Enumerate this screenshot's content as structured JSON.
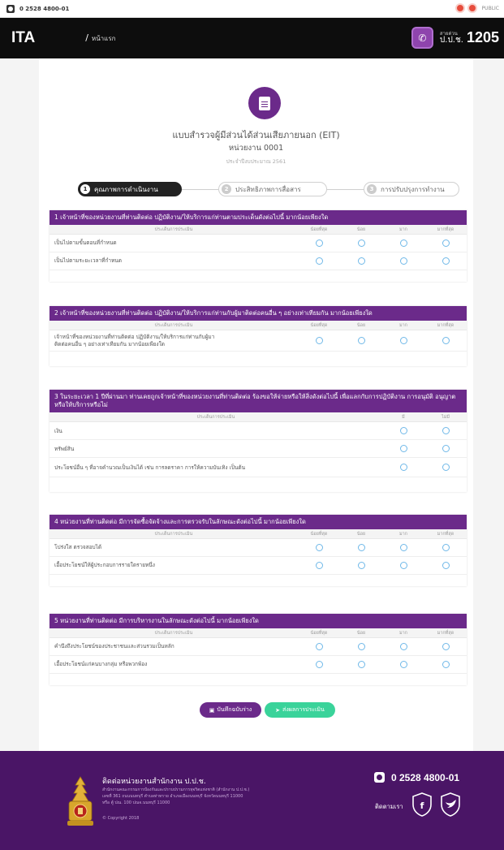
{
  "topbar": {
    "phone": "0 2528 4800-01",
    "public_label": "PUBLIC"
  },
  "header": {
    "logo": "ITA",
    "breadcrumb": "หน้าแรก",
    "hotline_label": "สายด่วน",
    "hotline_org": "ป.ป.ช.",
    "hotline_number": "1205"
  },
  "form": {
    "title": "แบบสำรวจผู้มีส่วนได้ส่วนเสียภายนอก (EIT)",
    "agency": "หน่วยงาน 0001",
    "year": "ประจำปีงบประมาณ 2561"
  },
  "steps": [
    {
      "num": "1",
      "label": "คุณภาพการดำเนินงาน"
    },
    {
      "num": "2",
      "label": "ประสิทธิภาพการสื่อสาร"
    },
    {
      "num": "3",
      "label": "การปรับปรุงการทำงาน"
    }
  ],
  "scale4": [
    "น้อยที่สุด",
    "น้อย",
    "มาก",
    "มากที่สุด"
  ],
  "scale2": [
    "มี",
    "ไม่มี"
  ],
  "sections": [
    {
      "title": "1 เจ้าหน้าที่ของหน่วยงานที่ท่านติดต่อ ปฏิบัติงาน/ให้บริการแก่ท่านตามประเด็นดังต่อไปนี้ มากน้อยเพียงใด",
      "col_header": "ประเด็นการประเมิน",
      "rows": [
        "เป็นไปตามขั้นตอนที่กำหนด",
        "เป็นไปตามระยะเวลาที่กำหนด"
      ]
    },
    {
      "title": "2 เจ้าหน้าที่ของหน่วยงานที่ท่านติดต่อ ปฏิบัติงาน/ให้บริการแก่ท่านกับผู้มาติดต่อคนอื่น ๆ อย่างเท่าเทียมกัน มากน้อยเพียงใด",
      "col_header": "ประเด็นการประเมิน",
      "rows": [
        "เจ้าหน้าที่ของหน่วยงานที่ท่านติดต่อ ปฏิบัติงาน/ให้บริการแก่ท่านกับผู้มาติดต่อคนอื่น ๆ อย่างเท่าเทียมกัน มากน้อยเพียงใด"
      ]
    },
    {
      "title": "3 ในระยะเวลา 1 ปีที่ผ่านมา ท่านเคยถูกเจ้าหน้าที่ของหน่วยงานที่ท่านติดต่อ ร้องขอให้จ่ายหรือให้สิ่งดังต่อไปนี้ เพื่อแลกกับการปฏิบัติงาน การอนุมัติ อนุญาต หรือให้บริการหรือไม่",
      "col_header": "ประเด็นการประเมิน",
      "rows": [
        "เงิน",
        "ทรัพย์สิน",
        "ประโยชน์อื่น ๆ ที่อาจคำนวณเป็นเงินได้ เช่น การลดราคา การให้ความบันเทิง เป็นต้น"
      ]
    },
    {
      "title": "4 หน่วยงานที่ท่านติดต่อ มีการจัดซื้อจัดจ้างและการตรวจรับในลักษณะดังต่อไปนี้ มากน้อยเพียงใด",
      "col_header": "ประเด็นการประเมิน",
      "rows": [
        "โปร่งใส ตรวจสอบได้",
        "เอื้อประโยชน์ให้ผู้ประกอบการรายใดรายหนึ่ง"
      ]
    },
    {
      "title": "5 หน่วยงานที่ท่านติดต่อ มีการบริหารงานในลักษณะดังต่อไปนี้ มากน้อยเพียงใด",
      "col_header": "ประเด็นการประเมิน",
      "rows": [
        "คำนึงถึงประโยชน์ของประชาชนและส่วนรวมเป็นหลัก",
        "เอื้อประโยชน์แก่คนบางกลุ่ม หรือพวกพ้อง"
      ]
    }
  ],
  "actions": {
    "save": "บันทึกฉบับร่าง",
    "send": "ส่งผลการประเมิน"
  },
  "footer": {
    "title": "ติดต่อหน่วยงานสำนักงาน ป.ป.ช.",
    "address_lines": [
      "สำนักงานคณะกรรมการป้องกันและปราบปรามการทุจริตแห่งชาติ (สำนักงาน ป.ป.ช.)",
      "เลขที่ 361 ถนนนนทบุรี ตำบลท่าทราย อำเภอเมืองนนทบุรี จังหวัดนนทบุรี 11000",
      "หรือ ตู้ ปณ. 100 ปณจ.นนทบุรี 11000"
    ],
    "copyright": "© Copyright 2018",
    "phone": "0 2528 4800-01",
    "follow": "ติดตามเรา"
  },
  "colors": {
    "primary": "#6b2a8a",
    "footer": "#4a1566",
    "header": "#0d0d0d",
    "send": "#3ad39a",
    "radio": "#6fb8e8"
  }
}
